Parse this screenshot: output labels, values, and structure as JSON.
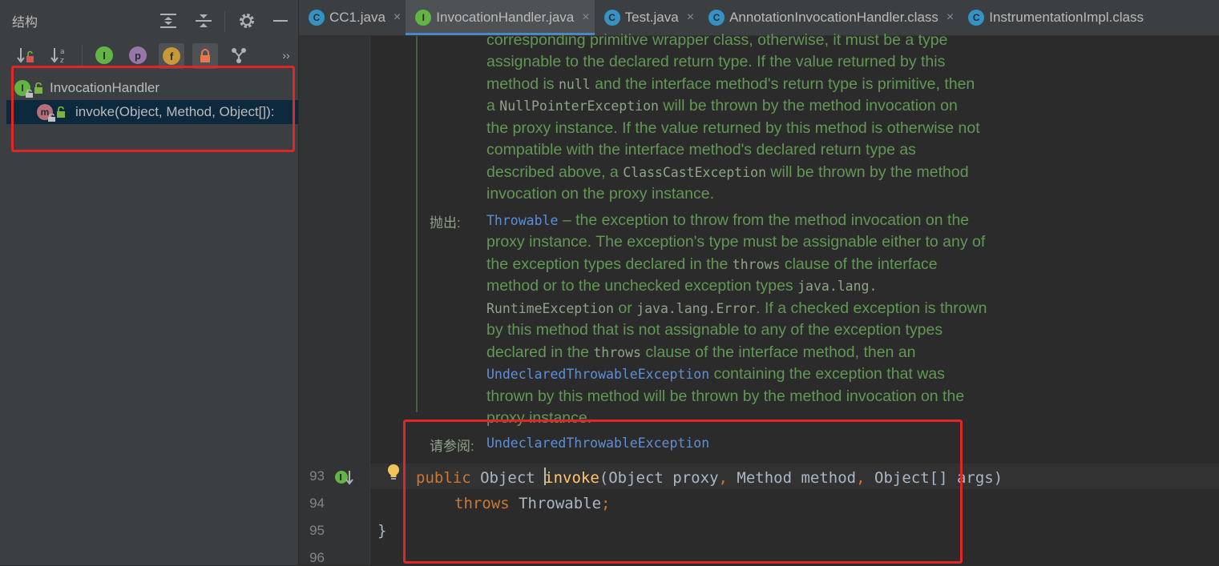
{
  "structure_panel": {
    "title": "结构",
    "tree": {
      "root_label": "InvocationHandler",
      "child_label": "invoke(Object, Method, Object[]):"
    },
    "toolbar_icons": [
      "expand-all-icon",
      "collapse-all-icon",
      "gear-icon",
      "minimize-icon"
    ],
    "filter_icons": {
      "inherited": "I",
      "properties": "p",
      "fields": "f",
      "more": "››"
    }
  },
  "tabs": [
    {
      "label": "CC1.java",
      "icon": "C",
      "color": "#3592c4"
    },
    {
      "label": "InvocationHandler.java",
      "icon": "I",
      "color": "#62b543"
    },
    {
      "label": "Test.java",
      "icon": "C",
      "color": "#3592c4"
    },
    {
      "label": "AnnotationInvocationHandler.class",
      "icon": "C",
      "color": "#3592c4"
    },
    {
      "label": "InstrumentationImpl.class",
      "icon": "C",
      "color": "#3592c4"
    }
  ],
  "close_glyph": "×",
  "doc": {
    "l0": "corresponding primitive wrapper class, otherwise, it must be a type",
    "l1": "assignable to the declared return type. If the value returned by this",
    "l2a": "method is ",
    "l2code": "null",
    "l2b": " and the interface method's return type is primitive, then",
    "l3a": "a ",
    "l3code": "NullPointerException",
    "l3b": " will be thrown by the method invocation on",
    "l4": "the proxy instance. If the value returned by this method is otherwise not",
    "l5": "compatible with the interface method's declared return type as",
    "l6a": "described above, a ",
    "l6code": "ClassCastException",
    "l6b": " will be thrown by the method",
    "l7": "invocation on the proxy instance.",
    "throws_label": "抛出:",
    "t0link": "Throwable",
    "t0b": " – the exception to throw from the method invocation on the",
    "t1": "proxy instance. The exception's type must be assignable either to any of",
    "t2a": "the exception types declared in the ",
    "t2code": "throws",
    "t2b": " clause of the interface",
    "t3a": "method or to the unchecked exception types ",
    "t3code": "java.lang.",
    "t4code": "RuntimeException",
    "t4b": " or ",
    "t4code2": "java.lang.Error",
    "t4c": ". If a checked exception is thrown",
    "t5": "by this method that is not assignable to any of the exception types",
    "t6a": "declared in the ",
    "t6code": "throws",
    "t6b": " clause of the interface method, then an",
    "t7link": "UndeclaredThrowableException",
    "t7b": " containing the exception that was",
    "t8": "thrown by this method will be thrown by the method invocation on the",
    "t9": "proxy instance.",
    "see_label": "请参阅:",
    "see_link": "UndeclaredThrowableException"
  },
  "code": {
    "line_numbers": [
      "93",
      "94",
      "95",
      "96"
    ],
    "l93_kw": "public",
    "l93_type": " Object ",
    "l93_fn": "invoke",
    "l93_rest1": "(Object proxy",
    "l93_comma1": ",",
    "l93_rest2": " Method method",
    "l93_comma2": ",",
    "l93_rest3": " Object[] args)",
    "l94_kw": "throws",
    "l94_type": " Throwable",
    "l94_semi": ";",
    "l95": "}"
  },
  "colors": {
    "highlight_box": "#e02626",
    "doc_text": "#629755",
    "keyword": "#cc7832",
    "method_name": "#ffc66d"
  }
}
